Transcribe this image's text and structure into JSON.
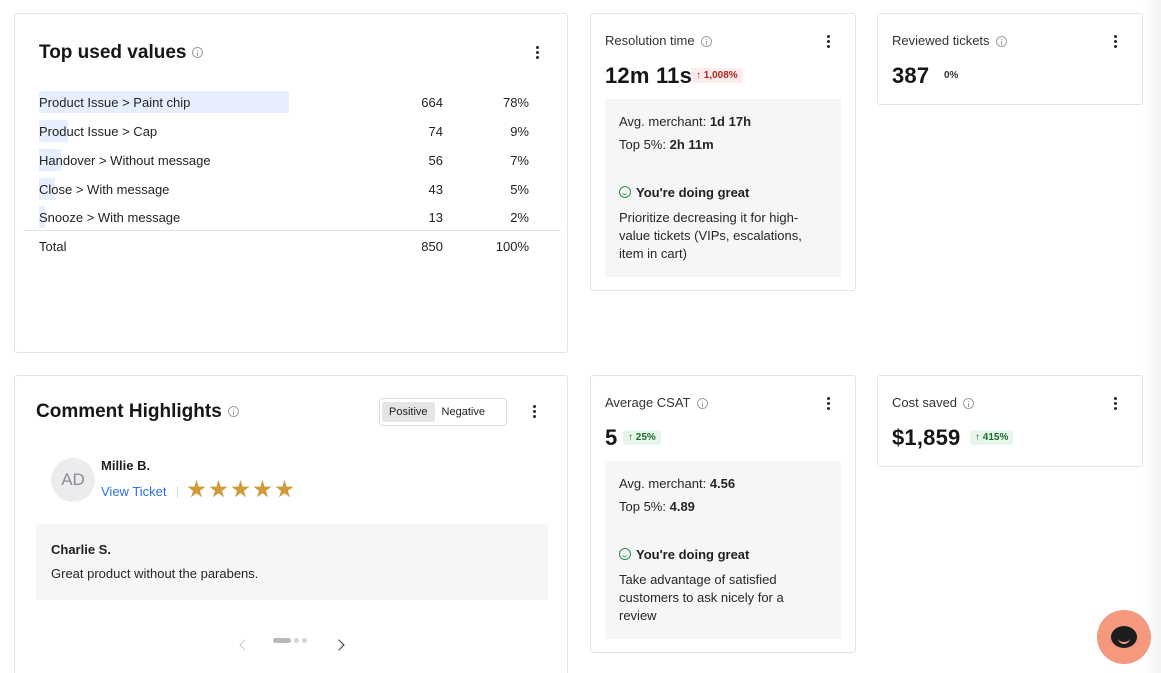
{
  "top_used_values": {
    "title": "Top used values",
    "rows": [
      {
        "label": "Product Issue > Paint chip",
        "count": "664",
        "percent": "78%",
        "share": 0.78
      },
      {
        "label": "Product Issue > Cap",
        "count": "74",
        "percent": "9%",
        "share": 0.09
      },
      {
        "label": "Handover > Without message",
        "count": "56",
        "percent": "7%",
        "share": 0.07
      },
      {
        "label": "Close > With message",
        "count": "43",
        "percent": "5%",
        "share": 0.05
      },
      {
        "label": "Snooze > With message",
        "count": "13",
        "percent": "2%",
        "share": 0.02
      }
    ],
    "total": {
      "label": "Total",
      "count": "850",
      "percent": "100%"
    }
  },
  "resolution_time": {
    "label": "Resolution time",
    "value": "12m 11s",
    "change": "1,008%",
    "avg_merchant_label": "Avg. merchant:",
    "avg_merchant_value": "1d 17h",
    "top5_label": "Top 5%:",
    "top5_value": "2h 11m",
    "status": "You're doing great",
    "advice": "Prioritize decreasing it for high-value tickets (VIPs, escalations, item in cart)"
  },
  "reviewed_tickets": {
    "label": "Reviewed tickets",
    "value": "387",
    "change": "0%"
  },
  "comment_highlights": {
    "title": "Comment Highlights",
    "tabs": [
      "Positive",
      "Negative"
    ],
    "active_tab": "Positive",
    "reviewer_initials": "AD",
    "reviewer_name": "Millie B.",
    "view_ticket": "View Ticket",
    "rating": 5,
    "comment_author": "Charlie S.",
    "comment_text": "Great product without the parabens."
  },
  "average_csat": {
    "label": "Average CSAT",
    "value": "5",
    "change": "25%",
    "avg_merchant_label": "Avg. merchant:",
    "avg_merchant_value": "4.56",
    "top5_label": "Top 5%:",
    "top5_value": "4.89",
    "status": "You're doing great",
    "advice": "Take advantage of satisfied customers to ask nicely for a review"
  },
  "cost_saved": {
    "label": "Cost saved",
    "value": "$1,859",
    "change": "415%"
  },
  "colors": {
    "accent_link": "#2f6fe0",
    "bar_fill": "#e6efff",
    "negative_badge": "#b3261e",
    "positive_badge": "#1b6e2c",
    "star": "#d19a3b",
    "chat_button": "#f4987e"
  },
  "icons": [
    "info-icon",
    "kebab-menu-icon",
    "arrow-up-icon",
    "smile-icon",
    "star-icon",
    "chevron-left-icon",
    "chevron-right-icon",
    "chat-icon"
  ]
}
